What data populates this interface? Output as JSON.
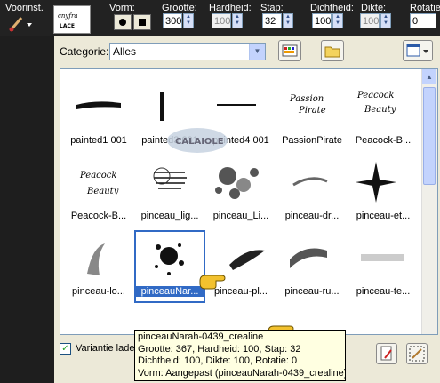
{
  "toolbar": {
    "preset_label": "Voorinst.",
    "shape_label": "Vorm:",
    "size_label": "Grootte:",
    "size_value": "300",
    "hardness_label": "Hardheid:",
    "hardness_value": "100",
    "step_label": "Stap:",
    "step_value": "32",
    "density_label": "Dichtheid:",
    "density_value": "100",
    "thickness_label": "Dikte:",
    "thickness_value": "100",
    "rotation_label": "Rotatie:",
    "rotation_value": "0"
  },
  "category": {
    "label": "Categorie:",
    "selected": "Alles"
  },
  "brushes": [
    {
      "label": "painted1 001",
      "icon": "stroke-horizontal"
    },
    {
      "label": "painted3 001",
      "icon": "stroke-vertical"
    },
    {
      "label": "painted4 001",
      "icon": "stroke-thin"
    },
    {
      "label": "PassionPirate",
      "icon": "text-brush"
    },
    {
      "label": "Peacock-B...",
      "icon": "text-brush"
    },
    {
      "label": "Peacock-B...",
      "icon": "text-brush"
    },
    {
      "label": "pinceau_lig...",
      "icon": "lines-brush"
    },
    {
      "label": "pinceau_Li...",
      "icon": "circles-brush"
    },
    {
      "label": "pinceau-dr...",
      "icon": "swoosh-brush"
    },
    {
      "label": "pinceau-et...",
      "icon": "star-brush"
    },
    {
      "label": "pinceau-lo...",
      "icon": "curve-brush"
    },
    {
      "label": "pinceauNar...",
      "icon": "splat-brush"
    },
    {
      "label": "pinceau-pl...",
      "icon": "feather-brush"
    },
    {
      "label": "pinceau-ru...",
      "icon": "ribbon-brush"
    },
    {
      "label": "pinceau-te...",
      "icon": "texture-brush"
    }
  ],
  "brush_texts": {
    "passion": "Passion",
    "pirate": "Pirate",
    "peacock": "Peacock",
    "beauty": "Beauty"
  },
  "watermark": "CALAIOLE",
  "variant_checkbox": {
    "label": "Variantie laden",
    "checked": true
  },
  "tooltip": {
    "line1": "pinceauNarah-0439_crealine",
    "line2": "Grootte: 367, Hardheid: 100, Stap: 32",
    "line3": "Dichtheid: 100, Dikte: 100, Rotatie: 0",
    "line4": "Vorm: Aangepast (pinceauNarah-0439_crealine)"
  },
  "colors": {
    "selection": "#316ac5",
    "pointer_hand": "#f2c12e",
    "toolbar_bg": "#222222"
  }
}
